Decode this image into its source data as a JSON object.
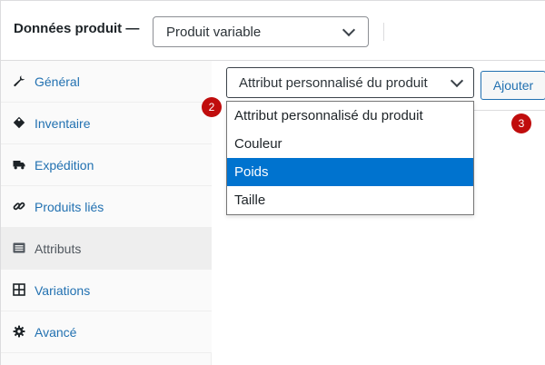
{
  "header": {
    "title": "Données produit —",
    "product_type": "Produit variable"
  },
  "sidebar": {
    "items": [
      {
        "label": "Général",
        "icon": "wrench-icon"
      },
      {
        "label": "Inventaire",
        "icon": "tag-icon"
      },
      {
        "label": "Expédition",
        "icon": "truck-icon"
      },
      {
        "label": "Produits liés",
        "icon": "link-icon"
      },
      {
        "label": "Attributs",
        "icon": "list-icon",
        "active": true
      },
      {
        "label": "Variations",
        "icon": "grid-icon"
      },
      {
        "label": "Avancé",
        "icon": "gear-icon"
      }
    ]
  },
  "attributes": {
    "select_value": "Attribut personnalisé du produit",
    "add_button": "Ajouter",
    "options": [
      {
        "label": "Attribut personnalisé du produit"
      },
      {
        "label": "Couleur"
      },
      {
        "label": "Poids",
        "highlighted": true
      },
      {
        "label": "Taille"
      }
    ]
  },
  "badges": {
    "step2": "2",
    "step3": "3"
  },
  "colors": {
    "link": "#2271b1",
    "highlight": "#0073cf",
    "badge": "#c00d0d",
    "sidebar_bg": "#fafafa",
    "sidebar_active_bg": "#eeeeee"
  }
}
